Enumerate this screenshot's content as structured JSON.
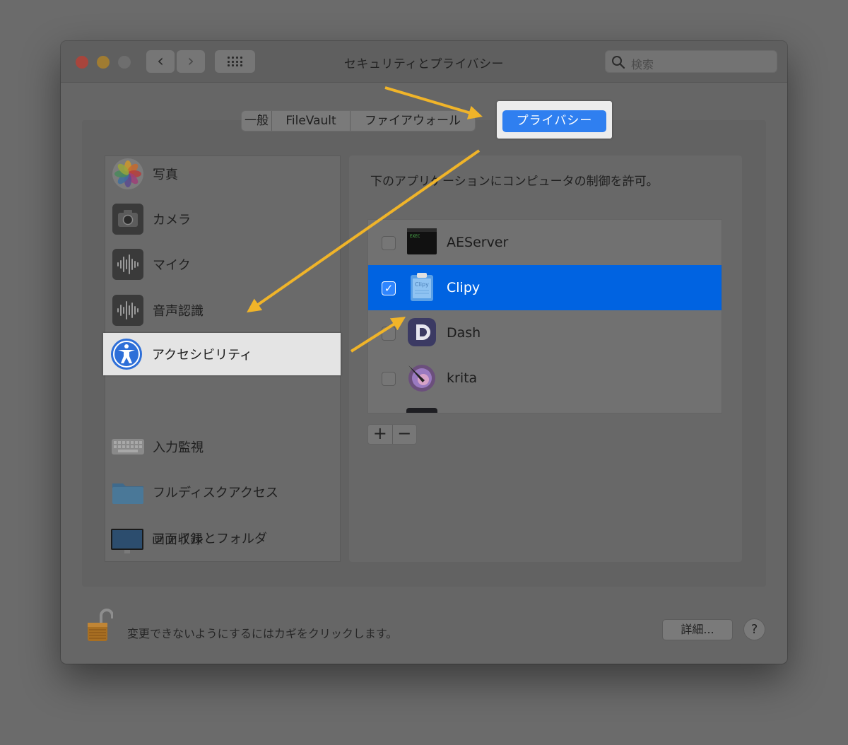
{
  "window": {
    "title": "セキュリティとプライバシー",
    "search_placeholder": "検索"
  },
  "tabs": [
    {
      "label": "一般",
      "active": false
    },
    {
      "label": "FileVault",
      "active": false
    },
    {
      "label": "ファイアウォール",
      "active": false
    },
    {
      "label": "プライバシー",
      "active": true
    }
  ],
  "categories": [
    {
      "label": "写真",
      "icon": "photos-icon"
    },
    {
      "label": "カメラ",
      "icon": "camera-icon"
    },
    {
      "label": "マイク",
      "icon": "microphone-icon"
    },
    {
      "label": "音声認識",
      "icon": "speech-recognition-icon"
    },
    {
      "label": "アクセシビリティ",
      "icon": "accessibility-icon",
      "selected": true
    },
    {
      "label": "入力監視",
      "icon": "keyboard-icon"
    },
    {
      "label": "フルディスクアクセス",
      "icon": "folder-icon"
    },
    {
      "label": "ファイルとフォルダ",
      "icon": "folder-icon"
    },
    {
      "label": "画面収録",
      "icon": "display-icon"
    }
  ],
  "panel": {
    "instruction": "下のアプリケーションにコンピュータの制御を許可。",
    "apps": [
      {
        "name": "AEServer",
        "checked": false,
        "icon": "terminal-icon"
      },
      {
        "name": "Clipy",
        "checked": true,
        "selected": true,
        "icon": "clipboard-icon"
      },
      {
        "name": "Dash",
        "checked": false,
        "icon": "dash-icon"
      },
      {
        "name": "krita",
        "checked": false,
        "icon": "krita-icon"
      }
    ],
    "plus_label": "+",
    "minus_label": "−"
  },
  "footer": {
    "lock_text": "変更できないようにするにはカギをクリックします。",
    "details_label": "詳細...",
    "help_label": "?"
  },
  "colors": {
    "selection_blue": "#0063e1",
    "tab_blue": "#2f7ff0",
    "annotation_arrow": "#f0b429"
  }
}
